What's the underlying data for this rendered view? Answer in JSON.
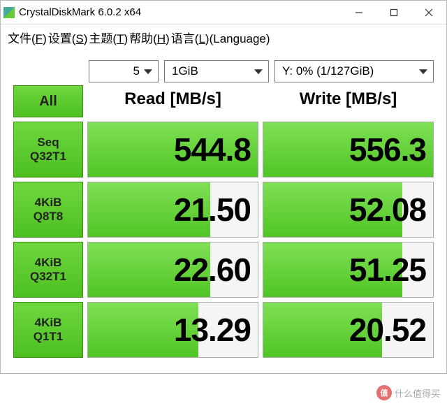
{
  "window": {
    "title": "CrystalDiskMark 6.0.2 x64"
  },
  "menu": {
    "file": "文件(F)",
    "settings": "设置(S)",
    "theme": "主题(T)",
    "help": "帮助(H)",
    "language": "语言(L)(Language)"
  },
  "controls": {
    "all_label": "All",
    "passes": "5",
    "size": "1GiB",
    "drive": "Y: 0% (1/127GiB)"
  },
  "headers": {
    "read": "Read [MB/s]",
    "write": "Write [MB/s]"
  },
  "tests": [
    {
      "l1": "Seq",
      "l2": "Q32T1",
      "read": "544.8",
      "write": "556.3",
      "rbar": 100,
      "wbar": 100
    },
    {
      "l1": "4KiB",
      "l2": "Q8T8",
      "read": "21.50",
      "write": "52.08",
      "rbar": 72,
      "wbar": 82
    },
    {
      "l1": "4KiB",
      "l2": "Q32T1",
      "read": "22.60",
      "write": "51.25",
      "rbar": 72,
      "wbar": 82
    },
    {
      "l1": "4KiB",
      "l2": "Q1T1",
      "read": "13.29",
      "write": "20.52",
      "rbar": 65,
      "wbar": 70
    }
  ],
  "watermark": {
    "icon": "值",
    "text": "什么值得买"
  },
  "chart_data": {
    "type": "table",
    "title": "CrystalDiskMark 6.0.2 x64 Benchmark",
    "columns": [
      "Test",
      "Read [MB/s]",
      "Write [MB/s]"
    ],
    "rows": [
      [
        "Seq Q32T1",
        544.8,
        556.3
      ],
      [
        "4KiB Q8T8",
        21.5,
        52.08
      ],
      [
        "4KiB Q32T1",
        22.6,
        51.25
      ],
      [
        "4KiB Q1T1",
        13.29,
        20.52
      ]
    ],
    "passes": 5,
    "test_size": "1GiB",
    "drive": "Y: 0% (1/127GiB)"
  }
}
